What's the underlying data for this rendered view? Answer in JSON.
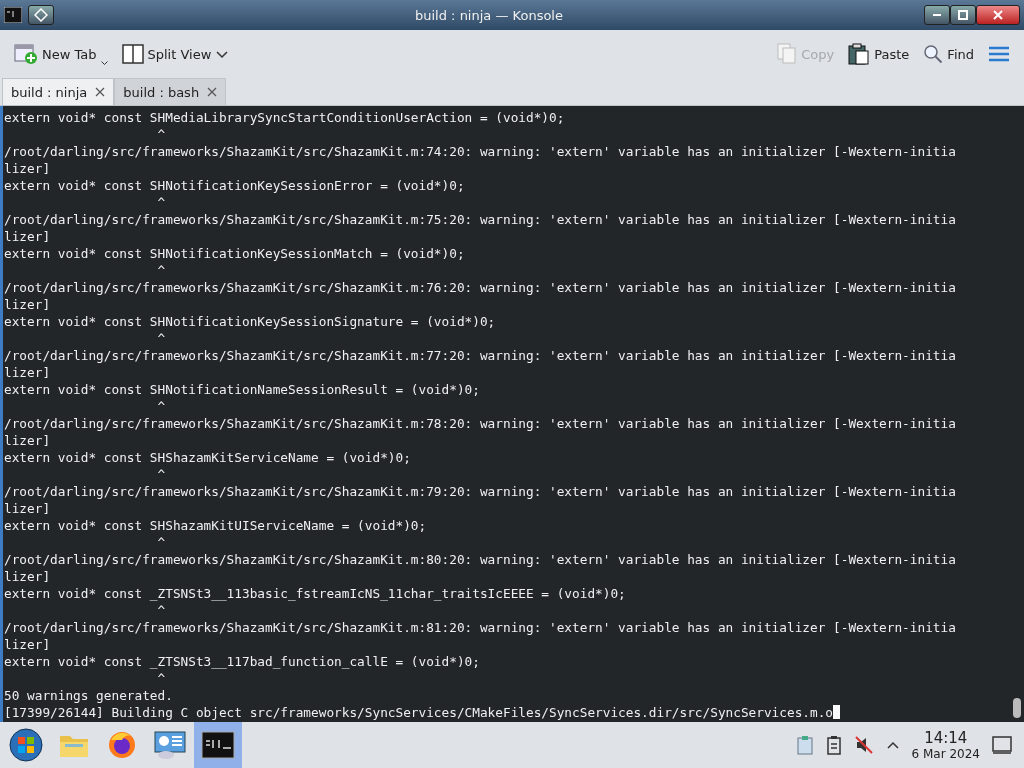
{
  "window": {
    "title": "build : ninja — Konsole"
  },
  "toolbar": {
    "left": [
      {
        "kind": "new-tab",
        "label": "New Tab",
        "disabled": false
      },
      {
        "kind": "split",
        "label": "Split View",
        "disabled": false
      }
    ],
    "right": [
      {
        "kind": "copy",
        "label": "Copy",
        "disabled": true
      },
      {
        "kind": "paste",
        "label": "Paste",
        "disabled": false
      },
      {
        "kind": "find",
        "label": "Find",
        "disabled": false
      }
    ]
  },
  "tabs": [
    {
      "label": "build : ninja",
      "selected": true
    },
    {
      "label": "build : bash",
      "selected": false
    }
  ],
  "terminal": {
    "lines": [
      "extern void* const SHMediaLibrarySyncStartConditionUserAction = (void*)0;",
      "                    ^",
      "/root/darling/src/frameworks/ShazamKit/src/ShazamKit.m:74:20: warning: 'extern' variable has an initializer [-Wextern-initia",
      "lizer]",
      "extern void* const SHNotificationKeySessionError = (void*)0;",
      "                    ^",
      "/root/darling/src/frameworks/ShazamKit/src/ShazamKit.m:75:20: warning: 'extern' variable has an initializer [-Wextern-initia",
      "lizer]",
      "extern void* const SHNotificationKeySessionMatch = (void*)0;",
      "                    ^",
      "/root/darling/src/frameworks/ShazamKit/src/ShazamKit.m:76:20: warning: 'extern' variable has an initializer [-Wextern-initia",
      "lizer]",
      "extern void* const SHNotificationKeySessionSignature = (void*)0;",
      "                    ^",
      "/root/darling/src/frameworks/ShazamKit/src/ShazamKit.m:77:20: warning: 'extern' variable has an initializer [-Wextern-initia",
      "lizer]",
      "extern void* const SHNotificationNameSessionResult = (void*)0;",
      "                    ^",
      "/root/darling/src/frameworks/ShazamKit/src/ShazamKit.m:78:20: warning: 'extern' variable has an initializer [-Wextern-initia",
      "lizer]",
      "extern void* const SHShazamKitServiceName = (void*)0;",
      "                    ^",
      "/root/darling/src/frameworks/ShazamKit/src/ShazamKit.m:79:20: warning: 'extern' variable has an initializer [-Wextern-initia",
      "lizer]",
      "extern void* const SHShazamKitUIServiceName = (void*)0;",
      "                    ^",
      "/root/darling/src/frameworks/ShazamKit/src/ShazamKit.m:80:20: warning: 'extern' variable has an initializer [-Wextern-initia",
      "lizer]",
      "extern void* const _ZTSNSt3__113basic_fstreamIcNS_11char_traitsIcEEEE = (void*)0;",
      "                    ^",
      "/root/darling/src/frameworks/ShazamKit/src/ShazamKit.m:81:20: warning: 'extern' variable has an initializer [-Wextern-initia",
      "lizer]",
      "extern void* const _ZTSNSt3__117bad_function_callE = (void*)0;",
      "                    ^",
      "50 warnings generated.",
      "[17399/26144] Building C object src/frameworks/SyncServices/CMakeFiles/SyncServices.dir/src/SyncServices.m.o"
    ]
  },
  "taskbar": {
    "apps": [
      {
        "kind": "start",
        "selected": false
      },
      {
        "kind": "files",
        "selected": false
      },
      {
        "kind": "browser",
        "selected": false
      },
      {
        "kind": "settings",
        "selected": false
      },
      {
        "kind": "terminal",
        "selected": true
      }
    ],
    "clock": {
      "time": "14:14",
      "date": "6 Mar 2024"
    }
  }
}
